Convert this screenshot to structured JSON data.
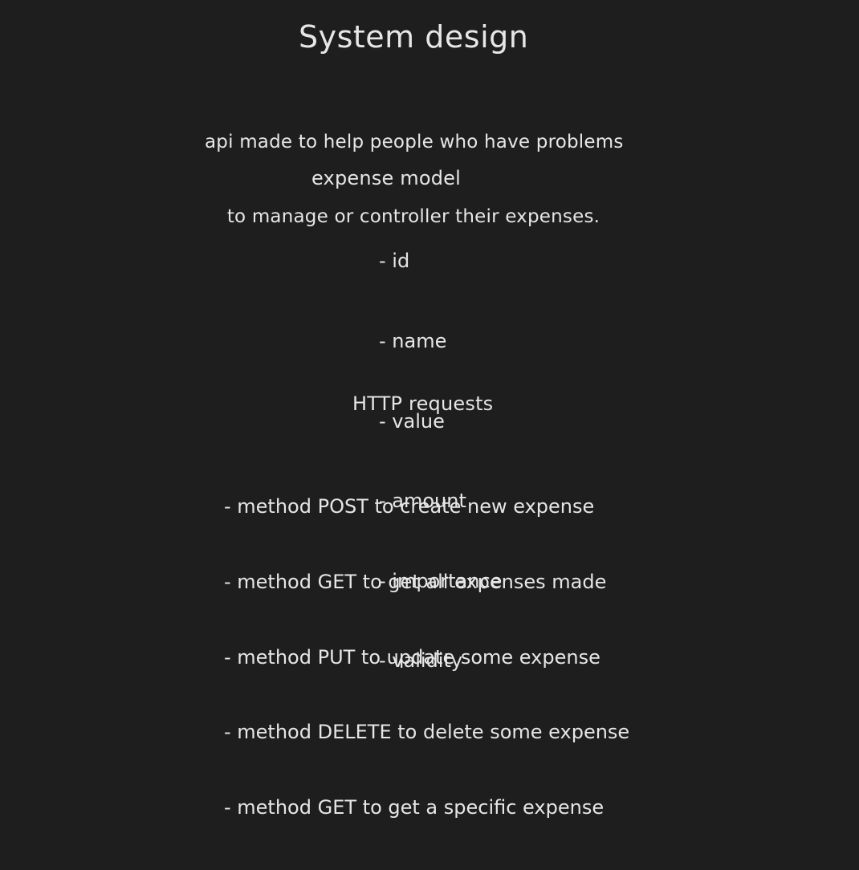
{
  "title": "System design",
  "description": [
    "api made to help people who have problems",
    "to manage or controller their expenses."
  ],
  "expense_model": {
    "title": "expense model",
    "fields": [
      "- id",
      "- name",
      "- value",
      "- amount",
      "- importance",
      "- validity"
    ]
  },
  "http_requests": {
    "title": "HTTP requests",
    "items": [
      "- method POST to create new expense",
      "- method GET to get all expenses made",
      "- method PUT to update some expense",
      "- method DELETE to delete some expense",
      "- method GET to get a specific expense"
    ]
  },
  "colors": {
    "background": "#1e1e1e",
    "text": "#e6e6e6"
  }
}
